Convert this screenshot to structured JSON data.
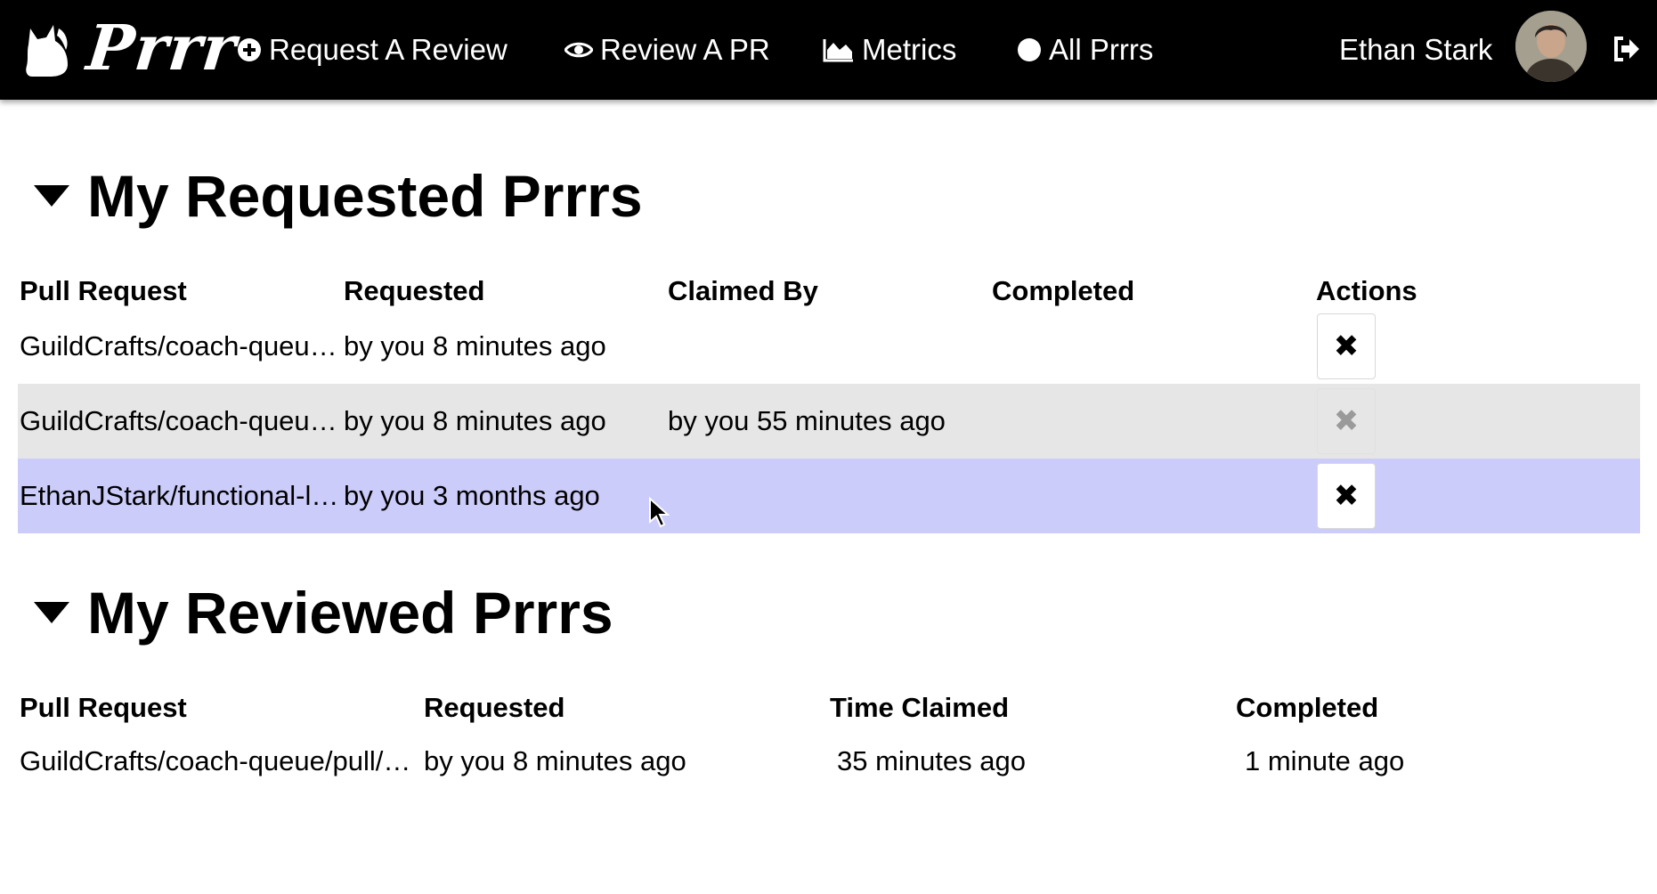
{
  "nav": {
    "brand": "Prrr",
    "request_review": "Request A Review",
    "review_pr": "Review A PR",
    "metrics": "Metrics",
    "all_prrrs": "All Prrrs",
    "user_name": "Ethan Stark"
  },
  "requested": {
    "title": "My Requested Prrrs",
    "headers": [
      "Pull Request",
      "Requested",
      "Claimed By",
      "Completed",
      "Actions"
    ],
    "rows": [
      {
        "pull_request": "GuildCrafts/coach-queue/pull/…",
        "requested": "by you 8 minutes ago",
        "claimed_by": "",
        "completed": "",
        "action": "✖",
        "action_enabled": true
      },
      {
        "pull_request": "GuildCrafts/coach-queue/pull/…",
        "requested": "by you 8 minutes ago",
        "claimed_by": "by you 55 minutes ago",
        "completed": "",
        "action": "✖",
        "action_enabled": false
      },
      {
        "pull_request": "EthanJStark/functional-light-js/…",
        "requested": "by you 3 months ago",
        "claimed_by": "",
        "completed": "",
        "action": "✖",
        "action_enabled": true
      }
    ]
  },
  "reviewed": {
    "title": "My Reviewed Prrrs",
    "headers": [
      "Pull Request",
      "Requested",
      "Time Claimed",
      "Completed"
    ],
    "rows": [
      {
        "pull_request": "GuildCrafts/coach-queue/pull/…",
        "requested": "by you 8 minutes ago",
        "time_claimed": "35 minutes ago",
        "completed": "1 minute ago"
      }
    ]
  },
  "colors": {
    "navbar_bg": "#000000",
    "row_alt_bg": "#e6e6e6",
    "row_hover_bg": "#ccccfb"
  },
  "icons": [
    "cat-logo-icon",
    "plus-circle-icon",
    "eye-icon",
    "area-chart-icon",
    "circle-icon",
    "sign-out-icon",
    "caret-down-icon",
    "close-icon"
  ]
}
